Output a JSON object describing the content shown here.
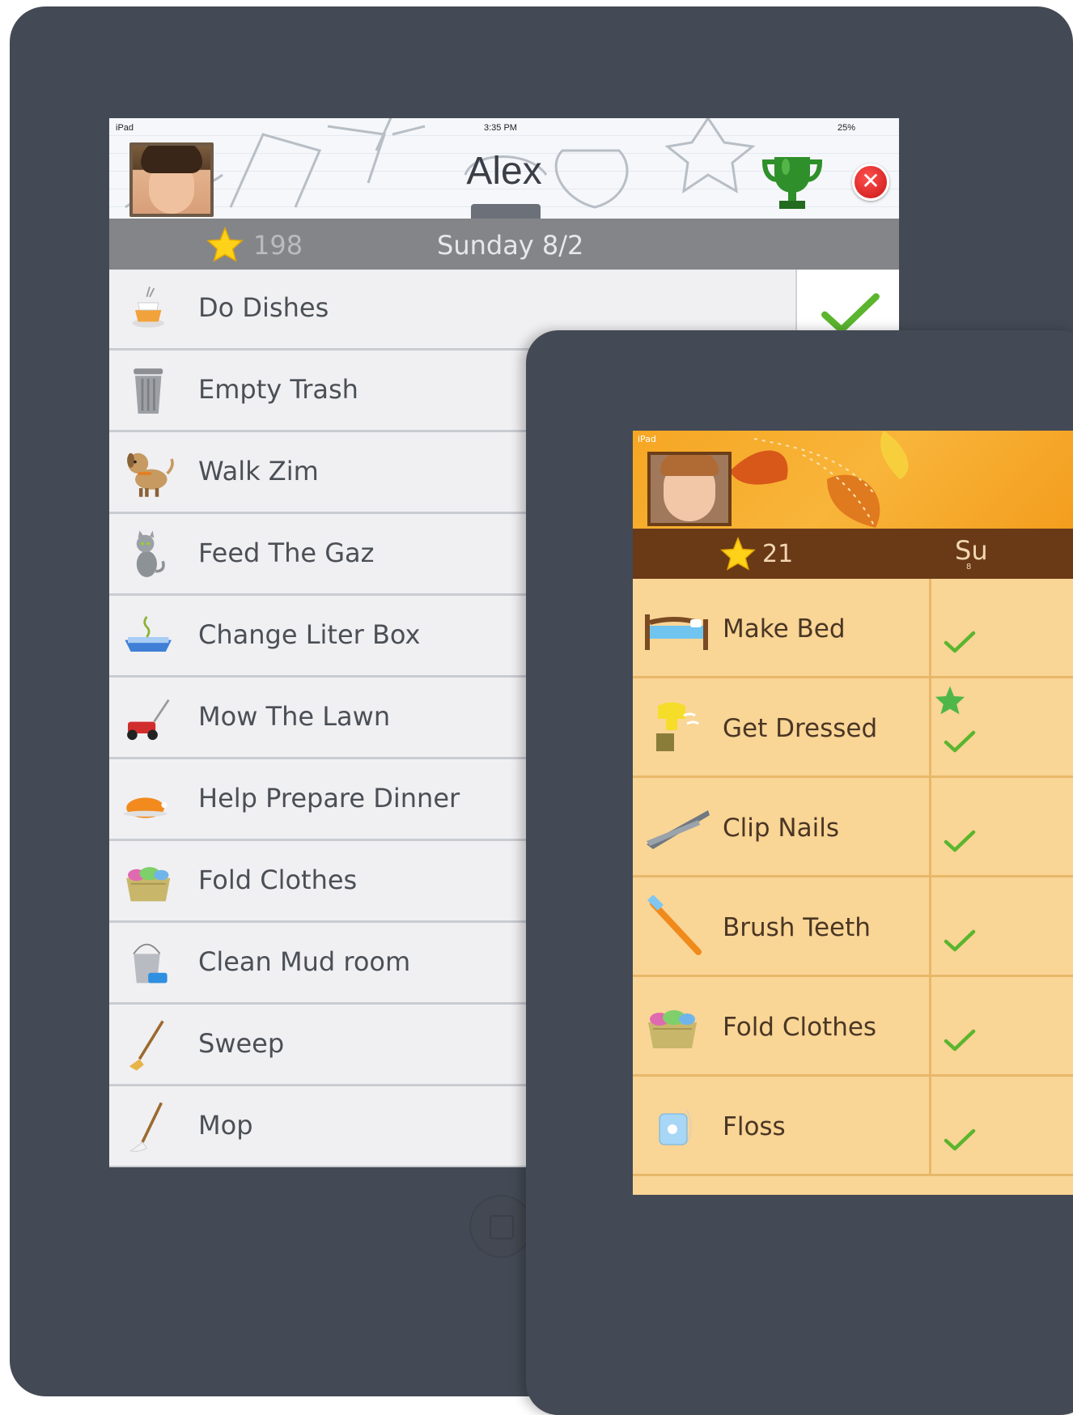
{
  "device_back": {
    "status": {
      "carrier": "iPad",
      "time": "3:35 PM",
      "battery": "25%"
    },
    "child_name": "Alex",
    "points": "198",
    "date": "Sunday 8/2",
    "icons": {
      "trophy": "trophy-icon",
      "close": "close-icon",
      "star": "star-icon"
    },
    "chores": [
      {
        "label": "Do Dishes",
        "icon": "dishes-icon",
        "checked": true
      },
      {
        "label": "Empty Trash",
        "icon": "trash-can-icon"
      },
      {
        "label": "Walk Zim",
        "icon": "dog-icon"
      },
      {
        "label": "Feed The Gaz",
        "icon": "cat-icon"
      },
      {
        "label": "Change Liter Box",
        "icon": "litter-box-icon"
      },
      {
        "label": "Mow The Lawn",
        "icon": "lawn-mower-icon"
      },
      {
        "label": "Help Prepare Dinner",
        "icon": "turkey-icon"
      },
      {
        "label": "Fold Clothes",
        "icon": "laundry-basket-icon"
      },
      {
        "label": "Clean Mud room",
        "icon": "bucket-icon"
      },
      {
        "label": "Sweep",
        "icon": "broom-icon"
      },
      {
        "label": "Mop",
        "icon": "mop-icon"
      }
    ]
  },
  "device_front": {
    "status": {
      "carrier": "iPad"
    },
    "points": "21",
    "date": "Su",
    "date_sub": "8",
    "chores": [
      {
        "label": "Make Bed",
        "icon": "bed-icon"
      },
      {
        "label": "Get Dressed",
        "icon": "clothes-icon",
        "bonus_star": true
      },
      {
        "label": "Clip Nails",
        "icon": "nail-clipper-icon"
      },
      {
        "label": "Brush Teeth",
        "icon": "toothbrush-icon"
      },
      {
        "label": "Fold Clothes",
        "icon": "laundry-basket-icon"
      },
      {
        "label": "Floss",
        "icon": "floss-icon"
      }
    ]
  },
  "colors": {
    "device": "#444a55",
    "check_green": "#5bb52e",
    "points_bar_back": "#838588",
    "points_bar_front": "#6a3a17",
    "row_front": "#f9d596"
  }
}
